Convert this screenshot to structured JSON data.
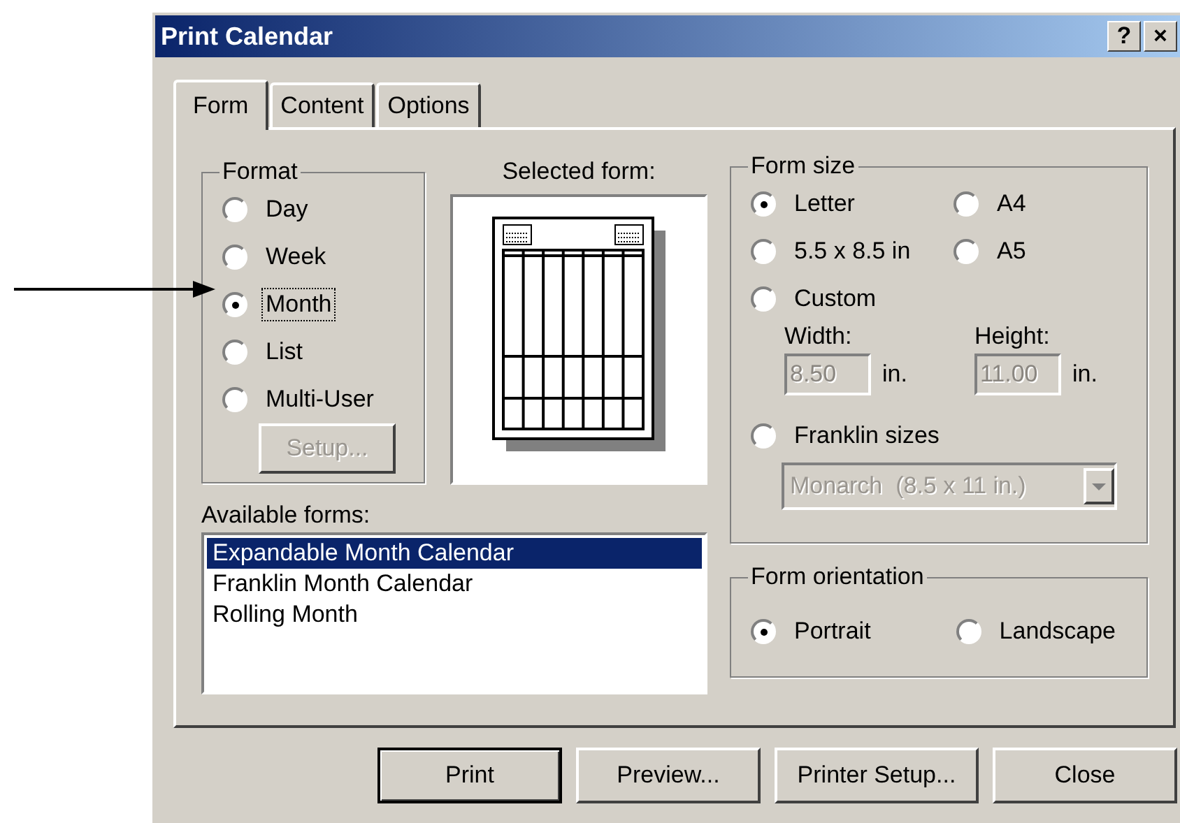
{
  "window": {
    "title": "Print Calendar",
    "help_button": "?",
    "close_button": "×"
  },
  "tabs": [
    {
      "label": "Form",
      "selected": true
    },
    {
      "label": "Content",
      "selected": false
    },
    {
      "label": "Options",
      "selected": false
    }
  ],
  "format": {
    "title": "Format",
    "options": [
      {
        "label": "Day",
        "selected": false,
        "focused": false
      },
      {
        "label": "Week",
        "selected": false,
        "focused": false
      },
      {
        "label": "Month",
        "selected": true,
        "focused": true
      },
      {
        "label": "List",
        "selected": false,
        "focused": false
      },
      {
        "label": "Multi-User",
        "selected": false,
        "focused": false
      }
    ],
    "setup_button": {
      "label": "Setup...",
      "disabled": true
    }
  },
  "preview": {
    "label": "Selected form:"
  },
  "available_forms": {
    "label": "Available forms:",
    "items": [
      {
        "label": "Expandable Month Calendar",
        "selected": true
      },
      {
        "label": "Franklin Month Calendar",
        "selected": false
      },
      {
        "label": "Rolling Month",
        "selected": false
      }
    ]
  },
  "form_size": {
    "title": "Form size",
    "options": [
      {
        "label": "Letter",
        "selected": true
      },
      {
        "label": "A4",
        "selected": false
      },
      {
        "label": "5.5 x 8.5 in",
        "selected": false
      },
      {
        "label": "A5",
        "selected": false
      },
      {
        "label": "Custom",
        "selected": false
      }
    ],
    "width": {
      "label": "Width:",
      "value": "8.50",
      "unit": "in.",
      "disabled": true
    },
    "height": {
      "label": "Height:",
      "value": "11.00",
      "unit": "in.",
      "disabled": true
    },
    "franklin": {
      "label": "Franklin sizes",
      "selected": false
    },
    "franklin_dropdown": {
      "value": "Monarch  (8.5 x 11 in.)",
      "disabled": true
    }
  },
  "orientation": {
    "title": "Form orientation",
    "options": [
      {
        "label": "Portrait",
        "selected": true
      },
      {
        "label": "Landscape",
        "selected": false
      }
    ]
  },
  "buttons": [
    {
      "label": "Print",
      "default": true
    },
    {
      "label": "Preview...",
      "default": false
    },
    {
      "label": "Printer Setup...",
      "default": false
    },
    {
      "label": "Close",
      "default": false
    }
  ]
}
